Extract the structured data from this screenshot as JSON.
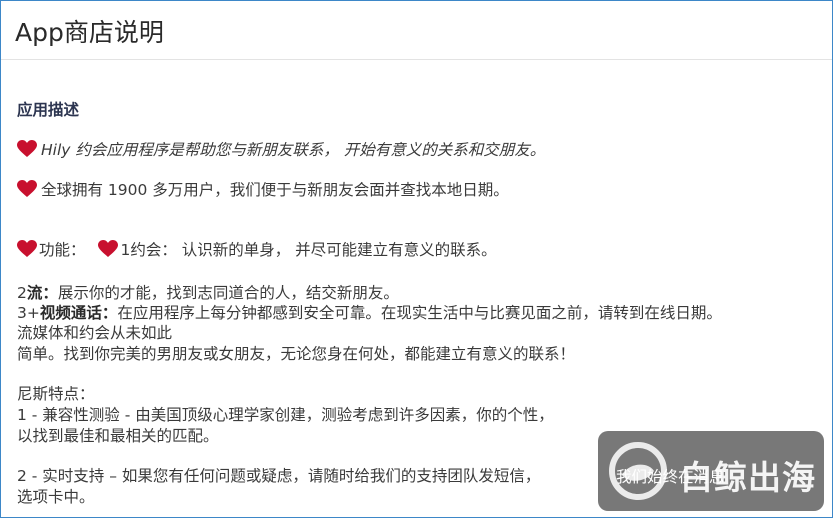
{
  "header": {
    "title": "App商店说明"
  },
  "content": {
    "section_heading": "应用描述",
    "intro_1": "Hily 约会应用程序是帮助您与新朋友联系， 开始有意义的关系和交朋友。",
    "intro_2": "全球拥有 1900 多万用户，我们便于与新朋友会面并查找本地日期。",
    "features_label": "功能：",
    "feature_1": "1约会： 认识新的单身， 并尽可能建立有意义的联系。",
    "feature_2_num": "2",
    "feature_2_title": "流：",
    "feature_2_text": "展示你的才能，找到志同道合的人，结交新朋友。",
    "feature_3_num": "3+",
    "feature_3_title": "视频通话：",
    "feature_3_text": "在应用程序上每分钟都感到安全可靠。在现实生活中与比赛见面之前，请转到在线日期。",
    "feature_3_cont": "流媒体和约会从未如此",
    "feature_3_cont2": "简单。找到你完美的男朋友或女朋友，无论您身在何处，都能建立有意义的联系！",
    "traits_heading": "尼斯特点：",
    "trait_1": "1 - 兼容性测验 - 由美国顶级心理学家创建，测验考虑到许多因素，你的个性，",
    "trait_1_cont": "以找到最佳和最相关的匹配。",
    "trait_2": "2 - 实时支持 – 如果您有任何问题或疑虑，请随时给我们的支持团队发短信，",
    "trait_2_overlay": "我们始终在消息",
    "trait_2_cont": "选项卡中。"
  },
  "watermark": {
    "text": "白鲸出海"
  },
  "colors": {
    "border": "#3d87c8",
    "heart": "#c8102e",
    "heading": "#2c3550"
  },
  "icons": {
    "heart": "red-heart-icon",
    "watermark_logo": "whale-logo-icon"
  }
}
